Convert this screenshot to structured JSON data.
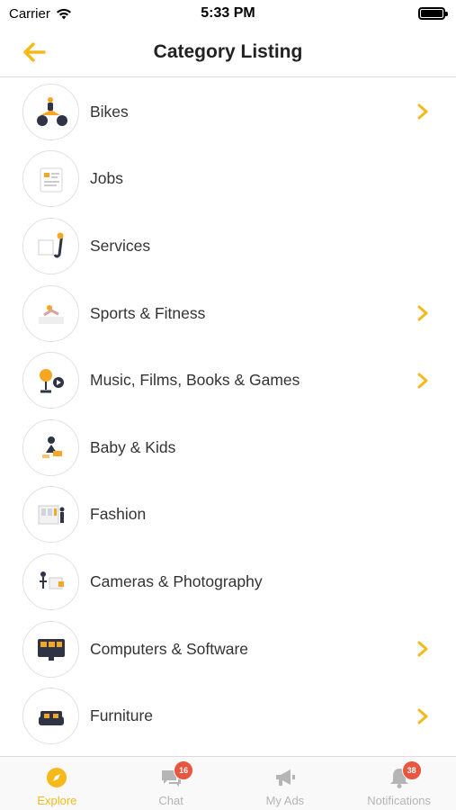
{
  "status_bar": {
    "carrier": "Carrier",
    "time": "5:33 PM"
  },
  "header": {
    "title": "Category Listing",
    "back_icon": "arrow-left-icon"
  },
  "colors": {
    "accent": "#f5b91a",
    "badge": "#e8563f",
    "inactive": "#b5b5b5"
  },
  "categories": [
    {
      "label": "Bikes",
      "has_chevron": true,
      "icon": "bike-illustration-icon"
    },
    {
      "label": "Jobs",
      "has_chevron": false,
      "icon": "jobs-illustration-icon"
    },
    {
      "label": "Services",
      "has_chevron": false,
      "icon": "services-illustration-icon"
    },
    {
      "label": "Sports & Fitness",
      "has_chevron": true,
      "icon": "sports-illustration-icon"
    },
    {
      "label": "Music, Films, Books & Games",
      "has_chevron": true,
      "icon": "music-illustration-icon"
    },
    {
      "label": "Baby & Kids",
      "has_chevron": false,
      "icon": "baby-illustration-icon"
    },
    {
      "label": "Fashion",
      "has_chevron": false,
      "icon": "fashion-illustration-icon"
    },
    {
      "label": "Cameras & Photography",
      "has_chevron": false,
      "icon": "camera-illustration-icon"
    },
    {
      "label": "Computers & Software",
      "has_chevron": true,
      "icon": "computer-illustration-icon"
    },
    {
      "label": "Furniture",
      "has_chevron": true,
      "icon": "furniture-illustration-icon"
    }
  ],
  "tabs": [
    {
      "label": "Explore",
      "icon": "compass-icon",
      "active": true,
      "badge": ""
    },
    {
      "label": "Chat",
      "icon": "chat-icon",
      "active": false,
      "badge": "16"
    },
    {
      "label": "My Ads",
      "icon": "megaphone-icon",
      "active": false,
      "badge": ""
    },
    {
      "label": "Notifications",
      "icon": "bell-icon",
      "active": false,
      "badge": "38"
    }
  ]
}
